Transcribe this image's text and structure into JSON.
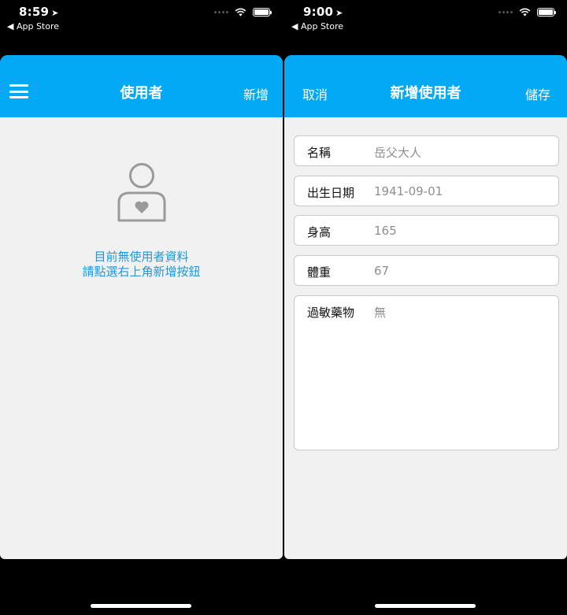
{
  "left": {
    "status": {
      "time": "8:59",
      "back_app": "◀ App Store"
    },
    "nav": {
      "title": "使用者",
      "add_label": "新增"
    },
    "empty": {
      "line1": "目前無使用者資料",
      "line2": "請點選右上角新增按鈕"
    }
  },
  "right": {
    "status": {
      "time": "9:00",
      "back_app": "◀ App Store"
    },
    "nav": {
      "title": "新增使用者",
      "cancel_label": "取消",
      "save_label": "儲存"
    },
    "form": {
      "name": {
        "label": "名稱",
        "value": "岳父大人"
      },
      "birthday": {
        "label": "出生日期",
        "value": "1941-09-01"
      },
      "height": {
        "label": "身高",
        "value": "165"
      },
      "weight": {
        "label": "體重",
        "value": "67"
      },
      "allergy": {
        "label": "過敏藥物",
        "value": "無"
      }
    }
  },
  "colors": {
    "accent": "#03a9f4",
    "empty_text": "#1f98d9",
    "background": "#f2f1f2",
    "placeholder": "#8e8e8e"
  },
  "icons": [
    "location-arrow-icon",
    "wifi-icon",
    "battery-icon",
    "hamburger-menu-icon",
    "user-heart-icon"
  ]
}
